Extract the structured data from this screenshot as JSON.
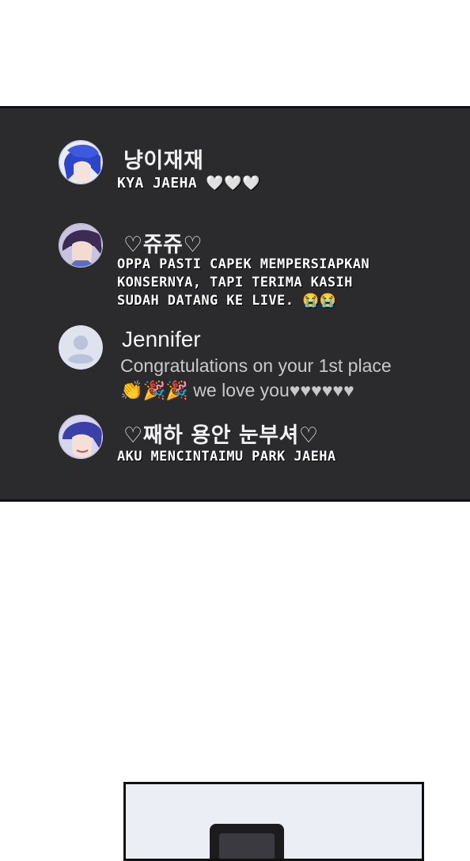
{
  "comments": [
    {
      "name": "냥이재재",
      "text": "KYA JAEHA 🤍🤍🤍",
      "avatar": "avatar-blue-hair"
    },
    {
      "name": "♡쥬쥬♡",
      "text": "OPPA PASTI CAPEK MEMPERSIAPKAN\nKONSERNYA, TAPI TERIMA KASIH\nSUDAH DATANG KE LIVE. 😭😭",
      "avatar": "avatar-purple-hair"
    },
    {
      "name": "Jennifer",
      "text": "Congratulations on your 1st place\n👏🎉🎉 we love you♥♥♥♥♥♥",
      "avatar": "default-user-icon"
    },
    {
      "name": "♡째하 용안 눈부셔♡",
      "text": "AKU MENCINTAIMU PARK JAEHA",
      "avatar": "avatar-blue-hair-smile"
    }
  ],
  "colors": {
    "panel": "#2b2b2d",
    "name_text": "#f2f2f2",
    "default_avatar_bg": "#dfe3ee",
    "default_avatar_fg": "#b9c3da"
  }
}
